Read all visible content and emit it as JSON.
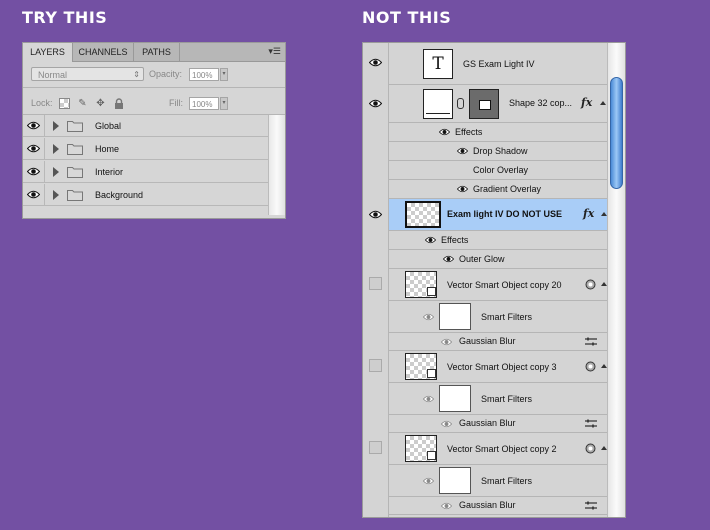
{
  "headers": {
    "try": "TRY THIS",
    "not": "NOT THIS"
  },
  "left_panel": {
    "tabs": [
      "LAYERS",
      "CHANNELS",
      "PATHS"
    ],
    "blend_mode": "Normal",
    "opacity_label": "Opacity:",
    "opacity_value": "100%",
    "lock_label": "Lock:",
    "fill_label": "Fill:",
    "fill_value": "100%",
    "layers": [
      "Global",
      "Home",
      "Interior",
      "Background"
    ]
  },
  "right_panel": {
    "text_layer": "GS Exam Light IV",
    "shape_layer": "Shape 32 cop...",
    "effects_label": "Effects",
    "shape_effects": [
      "Drop Shadow",
      "Color Overlay",
      "Gradient Overlay"
    ],
    "selected_layer": "Exam light IV DO NOT USE",
    "selected_effects": [
      "Outer Glow"
    ],
    "smart_objects": [
      {
        "name": "Vector Smart Object copy 20",
        "filters_label": "Smart Filters",
        "filter": "Gaussian Blur"
      },
      {
        "name": "Vector Smart Object copy 3",
        "filters_label": "Smart Filters",
        "filter": "Gaussian Blur"
      },
      {
        "name": "Vector Smart Object copy 2",
        "filters_label": "Smart Filters",
        "filter": "Gaussian Blur"
      }
    ],
    "text_thumb_glyph": "T",
    "fx_label": "fx",
    "selected_color": "#a9cdf7"
  }
}
